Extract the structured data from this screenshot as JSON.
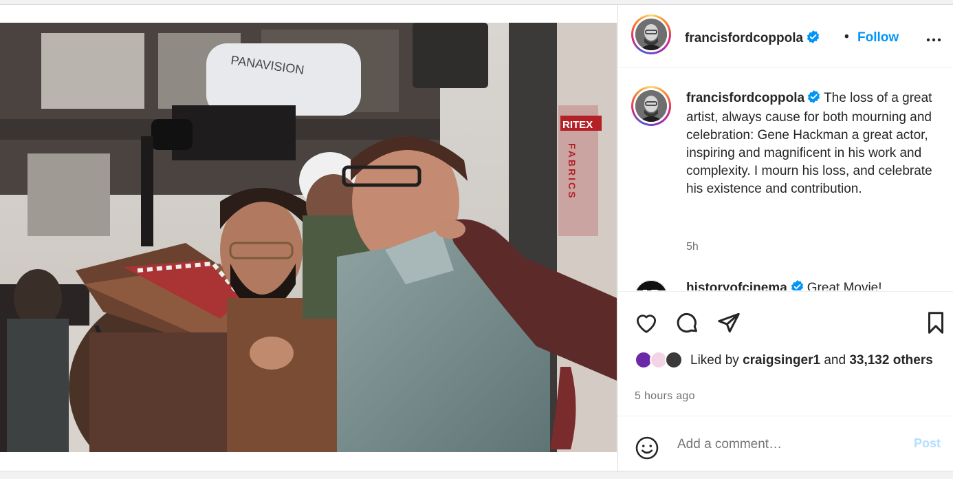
{
  "post": {
    "photo_alt": "photo",
    "photo_sign_camera": "PANAVISION",
    "photo_sign_store_top": "RITEX",
    "photo_sign_store_vertical": "FABRICS"
  },
  "header": {
    "username": "francisfordcoppola",
    "separator": "•",
    "follow_label": "Follow",
    "more_icon": "more-horizontal-icon",
    "verified_icon": "verified-badge-icon"
  },
  "caption": {
    "username": "francisfordcoppola",
    "text": "The loss of a great artist, always cause for both mourning and celebration: Gene Hackman a great actor, inspiring and magnificent in his work and complexity. I mourn his loss, and celebrate his existence and contribution.",
    "time": "5h"
  },
  "comments": [
    {
      "username": "historyofcinema",
      "text": "Great Movie!"
    }
  ],
  "actions": {
    "like_icon": "heart-icon",
    "comment_icon": "comment-icon",
    "share_icon": "send-icon",
    "save_icon": "bookmark-icon"
  },
  "likes": {
    "prefix": "Liked by",
    "user": "craigsinger1",
    "connector": "and",
    "count": "33,132",
    "suffix": "others"
  },
  "timestamp": "5 hours ago",
  "add_comment": {
    "placeholder": "Add a comment…",
    "post_label": "Post",
    "emoji_icon": "emoji-icon"
  },
  "colors": {
    "accent": "#0095f6",
    "post_disabled": "#b2dffc",
    "text": "#262626",
    "secondary": "#737373"
  }
}
